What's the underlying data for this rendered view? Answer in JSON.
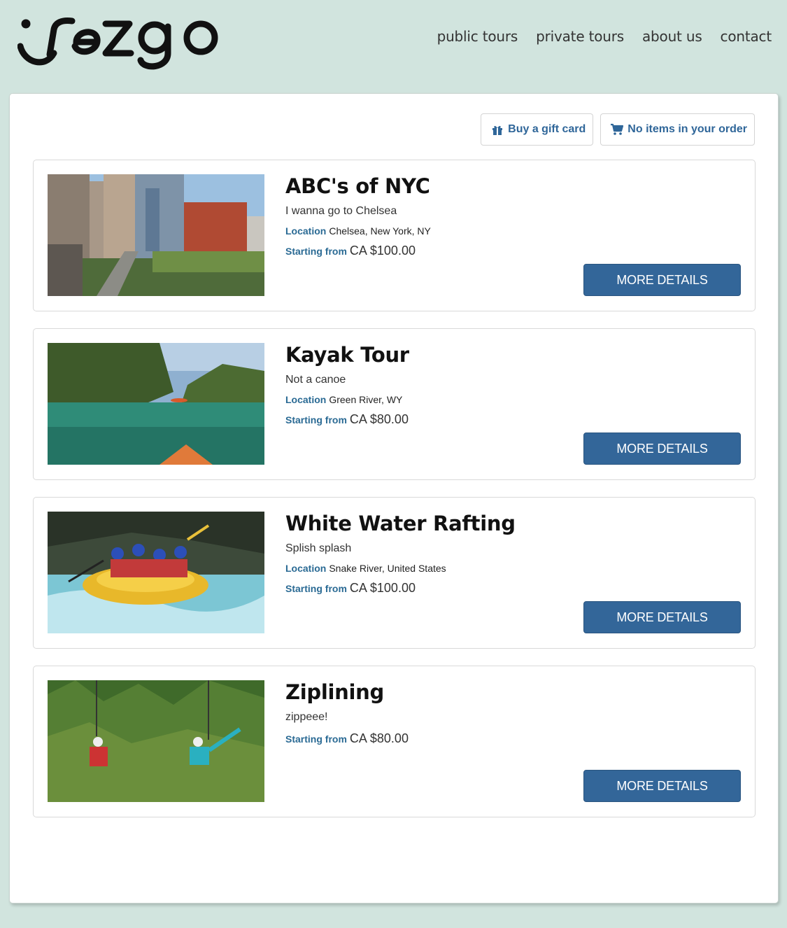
{
  "nav": {
    "items": [
      "public tours",
      "private tours",
      "about us",
      "contact"
    ]
  },
  "logo": {
    "text": "rezgo",
    "icon": "rezgo-logo"
  },
  "top_buttons": {
    "gift": {
      "label": "Buy a gift card",
      "icon": "gift-icon"
    },
    "cart": {
      "label": "No items in your order",
      "icon": "cart-icon"
    }
  },
  "labels": {
    "location": "Location",
    "starting_from": "Starting from",
    "more_details": "MORE DETAILS"
  },
  "tours": [
    {
      "title": "ABC's of NYC",
      "subtitle": "I wanna go to Chelsea",
      "location": "Chelsea, New York, NY",
      "price": "CA $100.00"
    },
    {
      "title": "Kayak Tour",
      "subtitle": "Not a canoe",
      "location": "Green River, WY",
      "price": "CA $80.00"
    },
    {
      "title": "White Water Rafting",
      "subtitle": "Splish splash",
      "location": "Snake River, United States",
      "price": "CA $100.00"
    },
    {
      "title": "Ziplining",
      "subtitle": "zippeee!",
      "price": "CA $80.00"
    }
  ],
  "colors": {
    "page_bg": "#d1e4de",
    "accent": "#336699",
    "label_blue": "#2a6a94"
  }
}
